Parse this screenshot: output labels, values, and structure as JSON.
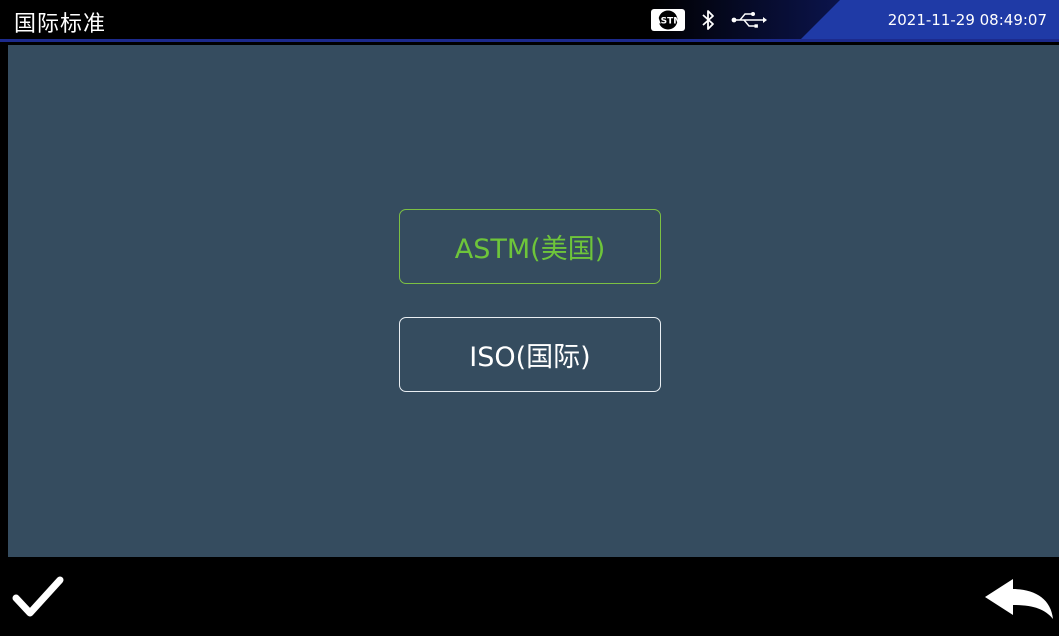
{
  "header": {
    "title": "国际标准",
    "datetime": "2021-11-29 08:49:07",
    "status_icons": [
      "astm-logo-icon",
      "bluetooth-icon",
      "usb-icon"
    ]
  },
  "options": [
    {
      "label": "ASTM(美国)",
      "selected": true
    },
    {
      "label": "ISO(国际)",
      "selected": false
    }
  ],
  "footer": {
    "confirm_icon": "checkmark-icon",
    "back_icon": "return-arrow-icon"
  },
  "colors": {
    "background": "#354c5f",
    "selected": "#6ec53a",
    "unselected": "#ffffff",
    "bar": "#000000",
    "accent": "#1f3aa6"
  }
}
